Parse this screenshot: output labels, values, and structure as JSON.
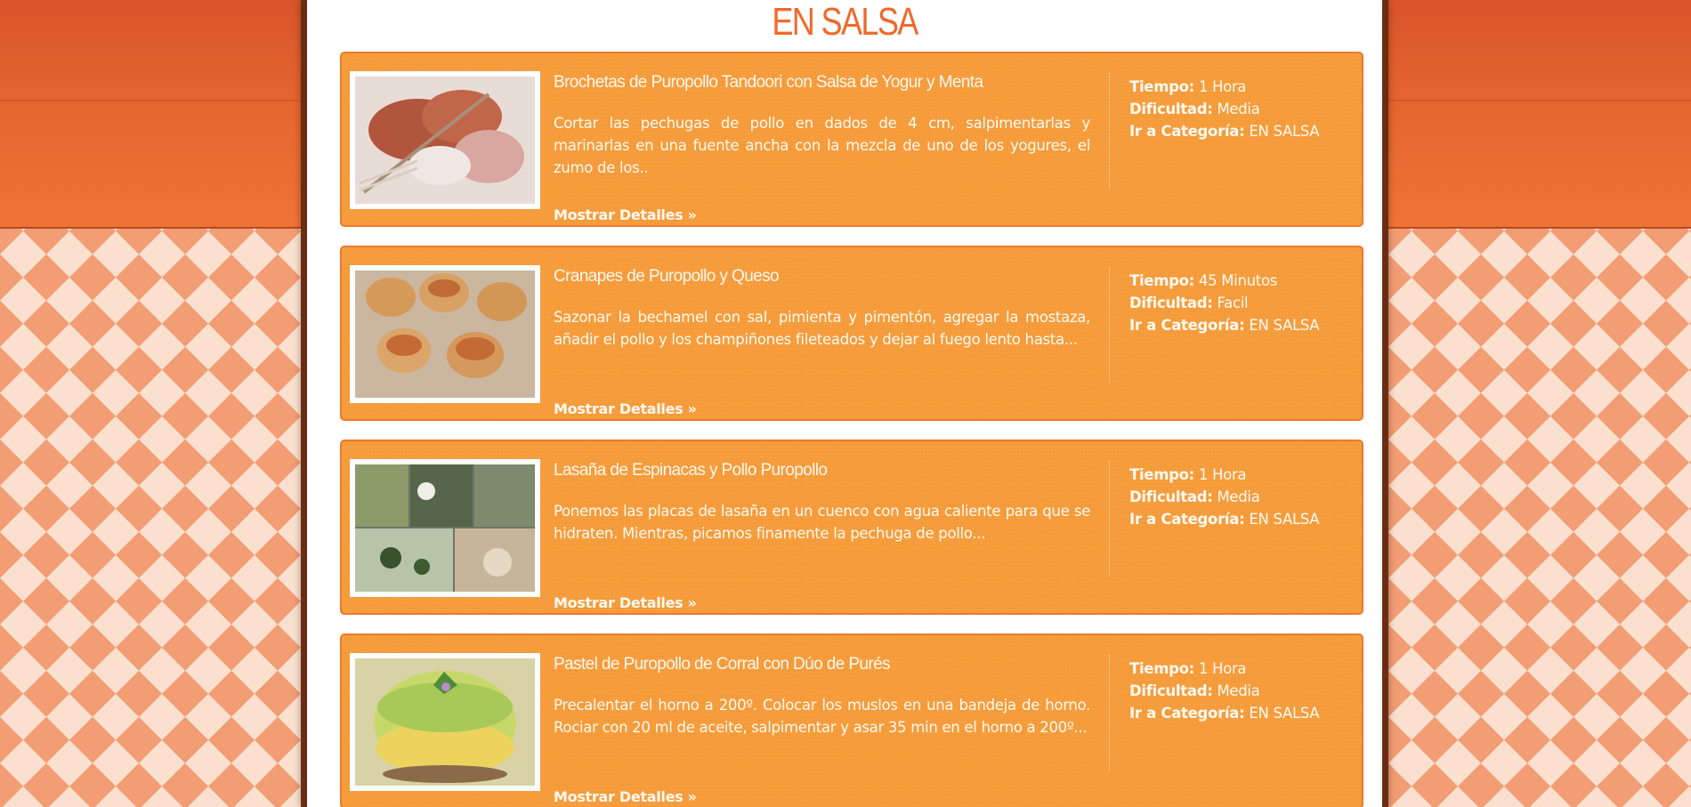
{
  "category": {
    "title": "EN SALSA"
  },
  "labels": {
    "time": "Tiempo:",
    "difficulty": "Dificultad:",
    "category": "Ir a Categoría:",
    "details": "Mostrar Detalles »"
  },
  "recipes": [
    {
      "title": "Brochetas de Puropollo Tandoori con Salsa de Yogur y Menta",
      "excerpt": "Cortar las pechugas de pollo en dados de 4 cm, salpimentarlas y marinarlas en una fuente ancha con la mezcla de uno de los yogures, el zumo de los..",
      "time": "1 Hora",
      "difficulty": "Media",
      "category": "EN SALSA"
    },
    {
      "title": "Cranapes de Puropollo y Queso",
      "excerpt": "Sazonar la bechamel con sal, pimienta y pimentón, agregar la mostaza, añadir el pollo y los champiñones fileteados y dejar al fuego lento hasta...",
      "time": "45 Minutos",
      "difficulty": "Facil",
      "category": "EN SALSA"
    },
    {
      "title": "Lasaña de Espinacas y Pollo Puropollo",
      "excerpt": "Ponemos las placas de lasaña en un cuenco con agua caliente para que se hidraten. Mientras, picamos finamente la pechuga de pollo...",
      "time": "1 Hora",
      "difficulty": "Media",
      "category": "EN SALSA"
    },
    {
      "title": "Pastel de Puropollo de Corral con Dúo de Purés",
      "excerpt": "Precalentar el horno a 200º. Colocar los muslos en una bandeja de horno. Rociar con 20 ml de aceite, salpimentar y asar 35 min en el horno a 200º...",
      "time": "1 Hora",
      "difficulty": "Media",
      "category": "EN SALSA"
    }
  ],
  "colors": {
    "card": "#f59b3a",
    "accent": "#ee6a2c",
    "frame": "#6b2d12"
  }
}
